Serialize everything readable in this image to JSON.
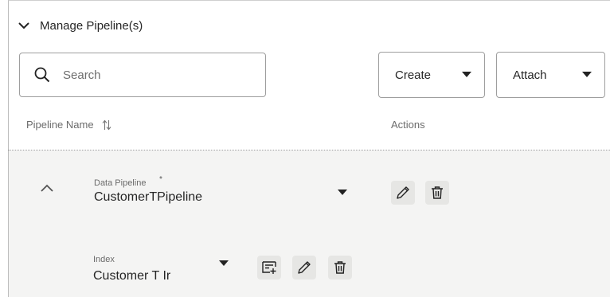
{
  "section": {
    "title": "Manage Pipeline(s)",
    "expanded": true
  },
  "search": {
    "placeholder": "Search",
    "value": ""
  },
  "buttons": {
    "create_label": "Create",
    "attach_label": "Attach"
  },
  "table": {
    "columns": [
      "Pipeline Name",
      "Actions"
    ],
    "rows": [
      {
        "field_label": "Data Pipeline",
        "required_mark": "*",
        "value": "CustomerTPipeline",
        "actions": [
          "edit-icon",
          "delete-icon"
        ],
        "sub_rows": [
          {
            "field_label": "Index",
            "value": "Customer T Ir",
            "actions": [
              "add-index-icon",
              "edit-icon",
              "delete-icon"
            ]
          }
        ]
      }
    ]
  },
  "colors": {
    "row_background": "#f4f4f3",
    "icon_button_bg": "#e6e6e4",
    "border": "#9e9e9e"
  }
}
